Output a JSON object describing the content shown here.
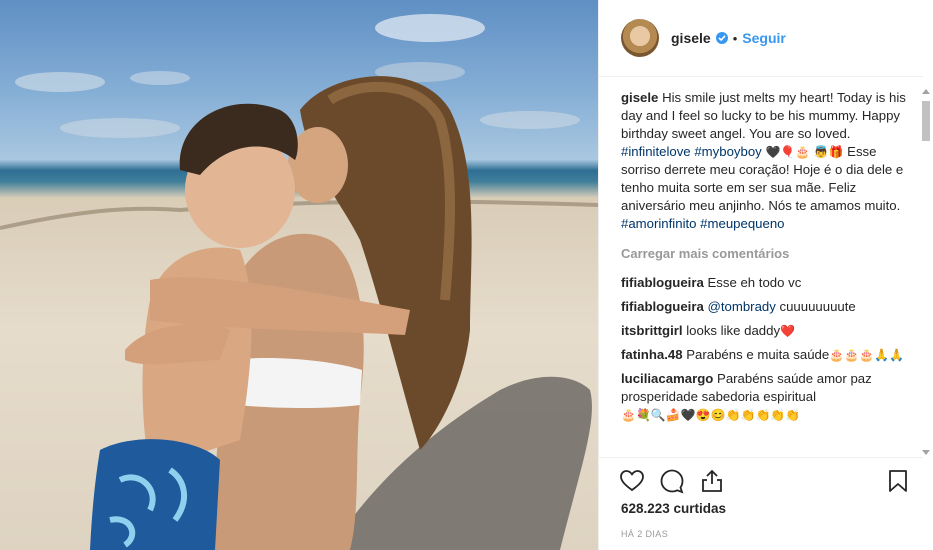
{
  "header": {
    "username": "gisele",
    "separator": "•",
    "follow_label": "Seguir"
  },
  "caption": {
    "username": "gisele",
    "text_part1": "His smile just melts my heart! Today is his day and I feel so lucky to be his mummy. Happy birthday sweet angel. You are so loved.",
    "hashtag1": "#infinitelove",
    "hashtag2": "#myboyboy",
    "emojis1": "🖤🎈🎂 👼🎁",
    "text_part2": "Esse sorriso derrete meu coração! Hoje é o dia dele e tenho muita sorte em ser sua mãe. Feliz aniversário meu anjinho. Nós te amamos muito.",
    "hashtag3": "#amorinfinito",
    "hashtag4": "#meupequeno"
  },
  "load_more_label": "Carregar mais comentários",
  "comments": [
    {
      "user": "fifiablogueira",
      "text": "Esse eh todo vc",
      "mention": "",
      "emojis": ""
    },
    {
      "user": "fifiablogueira",
      "text": "cuuuuuuuute",
      "mention": "@tombrady",
      "emojis": ""
    },
    {
      "user": "itsbrittgirl",
      "text": "looks like daddy",
      "mention": "",
      "emojis": "❤️"
    },
    {
      "user": "fatinha.48",
      "text": "Parabéns e muita saúde",
      "mention": "",
      "emojis": "🎂🎂🎂🙏🙏"
    },
    {
      "user": "luciliacamargo",
      "text": "Parabéns saúde amor paz prosperidade sabedoria espiritual",
      "mention": "",
      "emojis": "🎂💐🔍🍰🖤😍😊👏👏👏👏👏"
    }
  ],
  "likes_count": "628.223 curtidas",
  "post_date": "HÁ 2 DIAS",
  "icons": {
    "like": "heart-icon",
    "comment": "comment-icon",
    "share": "share-icon",
    "save": "bookmark-icon",
    "verified": "verified-badge-icon"
  },
  "colors": {
    "link": "#3897f0",
    "hashtag": "#003569",
    "muted": "#999999",
    "text": "#262626"
  }
}
